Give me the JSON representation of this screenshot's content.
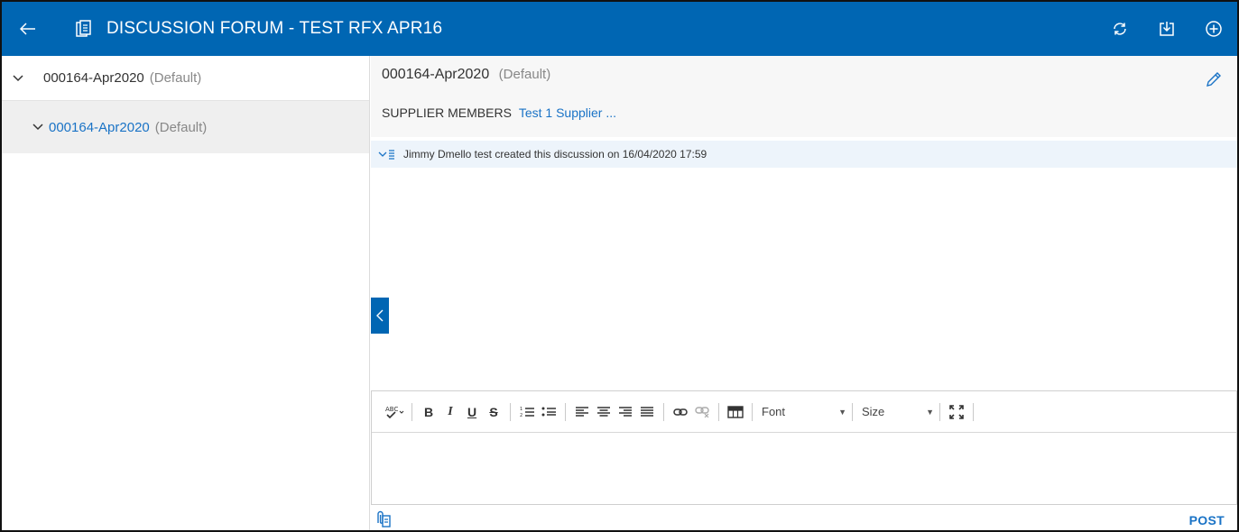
{
  "header": {
    "title": "DISCUSSION FORUM - TEST RFX APR16",
    "icons": [
      "back-arrow-icon",
      "document-icon",
      "refresh-icon",
      "download-icon",
      "add-circle-icon"
    ],
    "bg_color": "#0066b3"
  },
  "tree": {
    "root": {
      "name": "000164-Apr2020",
      "tag": "(Default)"
    },
    "child": {
      "name": "000164-Apr2020",
      "tag": "(Default)"
    }
  },
  "detail": {
    "title": "000164-Apr2020",
    "tag": "(Default)",
    "members_label": "SUPPLIER MEMBERS",
    "members_value": "Test 1 Supplier ..."
  },
  "discussion": {
    "entry": "Jimmy Dmello test created this discussion on 16/04/2020 17:59"
  },
  "editor": {
    "font_label": "Font",
    "size_label": "Size",
    "tools": [
      "spellcheck",
      "bold",
      "italic",
      "underline",
      "strikethrough",
      "numbered-list",
      "bulleted-list",
      "align-left",
      "align-center",
      "align-right",
      "justify",
      "link",
      "unlink",
      "table",
      "maximize"
    ]
  },
  "footer": {
    "post_label": "POST"
  },
  "colors": {
    "accent": "#0066b3",
    "link": "#1a73c6"
  }
}
